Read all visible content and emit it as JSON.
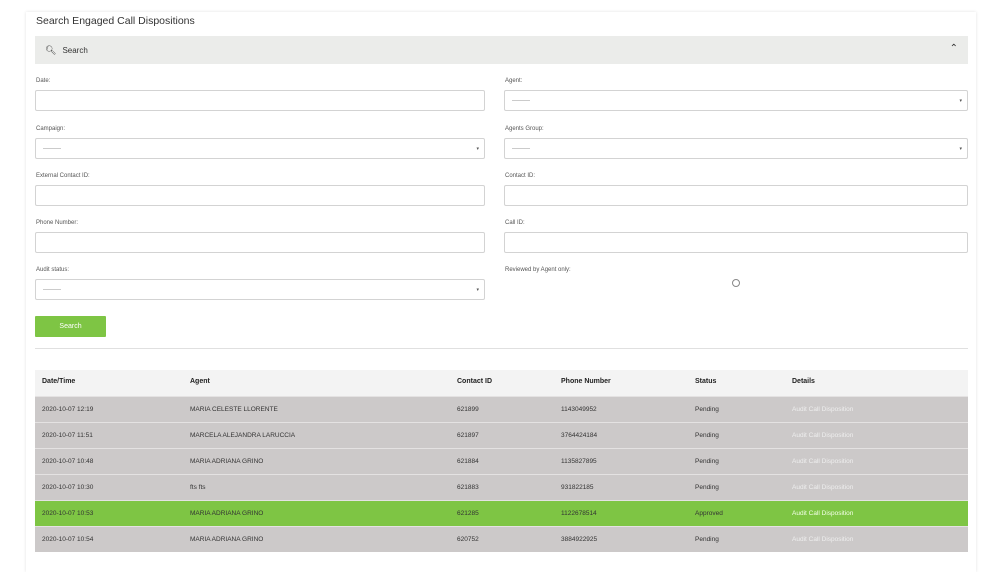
{
  "page_title": "Search Engaged Call Dispositions",
  "search_panel": {
    "title": "Search",
    "icon": "magnifier-icon",
    "toggle_icon": "chevron-up-icon"
  },
  "form": {
    "date": {
      "label": "Date:",
      "value": ""
    },
    "agent": {
      "label": "Agent:",
      "value": "---------"
    },
    "campaign": {
      "label": "Campaign:",
      "value": "---------"
    },
    "agents_group": {
      "label": "Agents Group:",
      "value": "---------"
    },
    "external_contact_id": {
      "label": "External Contact ID:",
      "value": ""
    },
    "contact_id": {
      "label": "Contact ID:",
      "value": ""
    },
    "phone_number": {
      "label": "Phone Number:",
      "value": ""
    },
    "call_id": {
      "label": "Call ID:",
      "value": ""
    },
    "audit_status": {
      "label": "Audit status:",
      "value": "---------"
    },
    "reviewed_by_agent_only": {
      "label": "Reviewed by Agent only:",
      "checked": false
    },
    "search_button": "Search"
  },
  "table": {
    "headers": [
      "Date/Time",
      "Agent",
      "Contact ID",
      "Phone Number",
      "Status",
      "Details"
    ],
    "rows": [
      {
        "datetime": "2020-10-07 12:19",
        "agent": "MARIA CELESTE LLORENTE",
        "contact_id": "621899",
        "phone": "1143049952",
        "status": "Pending",
        "details": "Audit Call Disposition",
        "highlight": false
      },
      {
        "datetime": "2020-10-07 11:51",
        "agent": "MARCELA ALEJANDRA LARUCCIA",
        "contact_id": "621897",
        "phone": "3764424184",
        "status": "Pending",
        "details": "Audit Call Disposition",
        "highlight": false
      },
      {
        "datetime": "2020-10-07 10:48",
        "agent": "MARIA ADRIANA GRINO",
        "contact_id": "621884",
        "phone": "1135827895",
        "status": "Pending",
        "details": "Audit Call Disposition",
        "highlight": false
      },
      {
        "datetime": "2020-10-07 10:30",
        "agent": "fts fts",
        "contact_id": "621883",
        "phone": "931822185",
        "status": "Pending",
        "details": "Audit Call Disposition",
        "highlight": false
      },
      {
        "datetime": "2020-10-07 10:53",
        "agent": "MARIA ADRIANA GRINO",
        "contact_id": "621285",
        "phone": "1122678514",
        "status": "Approved",
        "details": "Audit Call Disposition",
        "highlight": true
      },
      {
        "datetime": "2020-10-07 10:54",
        "agent": "MARIA ADRIANA GRINO",
        "contact_id": "620752",
        "phone": "3884922925",
        "status": "Pending",
        "details": "Audit Call Disposition",
        "highlight": false
      }
    ]
  },
  "colors": {
    "accent_green": "#7ec544",
    "row_grey": "#ccc9c9",
    "header_bg": "#ebecea"
  }
}
